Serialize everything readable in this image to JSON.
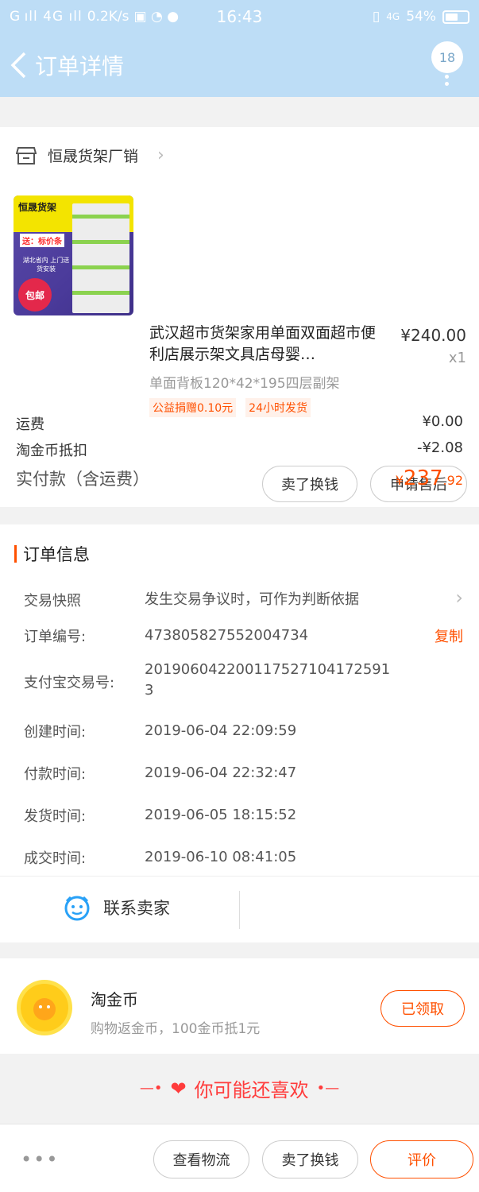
{
  "status_bar": {
    "signal": "G ıll 4G ıll",
    "speed": "0.2K/s",
    "time": "16:43",
    "network": "4G",
    "battery": "54%"
  },
  "header": {
    "title": "订单详情",
    "badge_count": "18"
  },
  "shop": {
    "name": "恒晟货架厂销"
  },
  "product": {
    "title": "武汉超市货架家用单面双面超市便利店展示架文具店母婴…",
    "price": "¥240.00",
    "quantity": "x1",
    "spec": "单面背板120*42*195四层副架",
    "tags": [
      "公益捐赠0.10元",
      "24小时发货"
    ],
    "image_text": {
      "brand": "恒晟货架",
      "promo": "送：标价条",
      "local": "湖北省内 上门送货安装",
      "seal": "包邮"
    },
    "buttons": {
      "resell": "卖了换钱",
      "after_sale": "申请售后"
    }
  },
  "fees": {
    "shipping_label": "运费",
    "shipping_value": "¥0.00",
    "coin_label": "淘金币抵扣",
    "coin_value": "-¥2.08",
    "paid_label": "实付款（含运费）",
    "paid_currency": "¥",
    "paid_integer": "237",
    "paid_decimal": ".92"
  },
  "order_info": {
    "heading": "订单信息",
    "rows": [
      {
        "label": "交易快照",
        "value": "发生交易争议时，可作为判断依据"
      },
      {
        "label": "订单编号:",
        "value": "473805827552004734",
        "action": "复制"
      },
      {
        "label": "支付宝交易号:",
        "value": "2019060422001175271041725913"
      },
      {
        "label": "创建时间:",
        "value": "2019-06-04 22:09:59"
      },
      {
        "label": "付款时间:",
        "value": "2019-06-04 22:32:47"
      },
      {
        "label": "发货时间:",
        "value": "2019-06-05 18:15:52"
      },
      {
        "label": "成交时间:",
        "value": "2019-06-10 08:41:05"
      }
    ]
  },
  "contact": {
    "label": "联系卖家"
  },
  "coin": {
    "title": "淘金币",
    "subtitle": "购物返金币，100金币抵1元",
    "button": "已领取"
  },
  "recommend": {
    "title": "你可能还喜欢"
  },
  "bottom_bar": {
    "more": "•••",
    "logistics": "查看物流",
    "resell": "卖了换钱",
    "review": "评价"
  },
  "colors": {
    "header_bg": "#bdddf6",
    "accent": "#ff5000",
    "recommend": "#ff3c3c"
  }
}
